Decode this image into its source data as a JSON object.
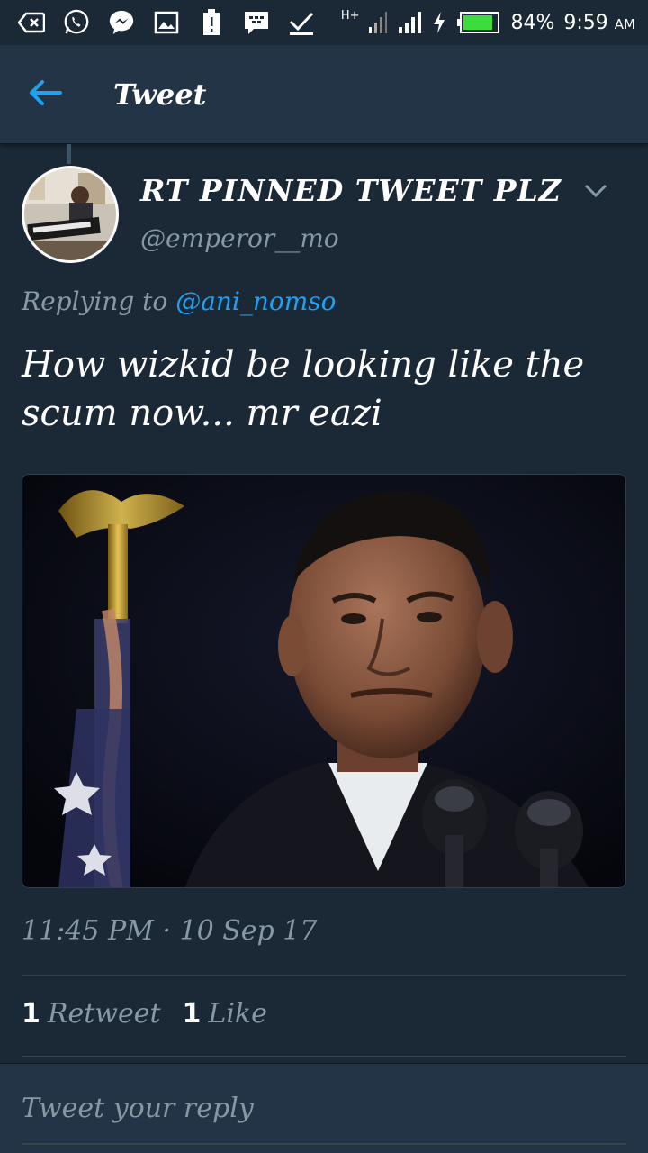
{
  "status_bar": {
    "network_type": "H+",
    "battery_percent": "84%",
    "time": "9:59",
    "time_suffix": "AM",
    "battery_level": 0.84,
    "icons": [
      "backspace-icon",
      "whatsapp-icon",
      "messenger-icon",
      "image-icon",
      "battery-alert-icon",
      "bbm-icon",
      "check-icon",
      "signal-icon",
      "signal-icon",
      "charging-icon",
      "battery-icon"
    ]
  },
  "header": {
    "title": "Tweet",
    "back_icon": "arrow-left-icon"
  },
  "tweet": {
    "display_name": "RT PINNED TWEET PLZ",
    "handle": "@emperor__mo",
    "replying_prefix": "Replying to",
    "replying_to": "@ani_nomso",
    "text": "How wizkid be looking like the scum now... mr eazi",
    "timestamp": "11:45 PM · 10 Sep 17",
    "retweets_count": "1",
    "retweets_label": "Retweet",
    "likes_count": "1",
    "likes_label": "Like"
  },
  "reply": {
    "placeholder": "Tweet your reply"
  },
  "colors": {
    "background": "#1b2836",
    "header_bg": "#243447",
    "accent": "#1da1f2",
    "secondary_text": "#8899a6"
  }
}
